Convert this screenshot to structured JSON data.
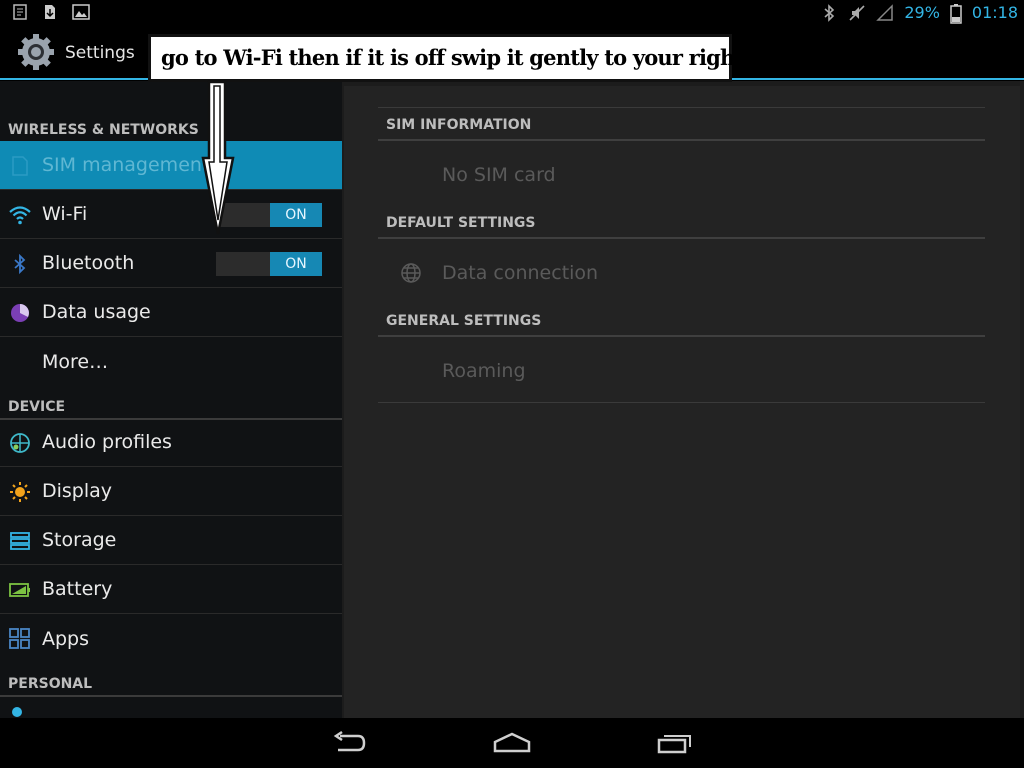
{
  "statusbar": {
    "battery_percent": "29%",
    "time": "01:18",
    "accent": "#33b5e5",
    "left_icons": [
      "notification-icon",
      "download-icon",
      "image-icon"
    ],
    "right_icons": [
      "bluetooth-icon",
      "mute-icon",
      "signal-icon",
      "battery-icon"
    ]
  },
  "actionbar": {
    "title": "Settings",
    "icon": "settings-gear-icon"
  },
  "annotation": {
    "text": "go to Wi-Fi then if it is off swip it gently to your right to ON"
  },
  "sidebar": {
    "sections": [
      {
        "header": "WIRELESS & NETWORKS",
        "items": [
          {
            "label": "SIM management",
            "icon": "sim-icon",
            "selected": true
          },
          {
            "label": "Wi-Fi",
            "icon": "wifi-icon",
            "toggle": "ON"
          },
          {
            "label": "Bluetooth",
            "icon": "bluetooth-icon",
            "toggle": "ON"
          },
          {
            "label": "Data usage",
            "icon": "data-usage-icon"
          },
          {
            "label": "More…",
            "icon": ""
          }
        ]
      },
      {
        "header": "DEVICE",
        "items": [
          {
            "label": "Audio profiles",
            "icon": "audio-profiles-icon"
          },
          {
            "label": "Display",
            "icon": "display-icon"
          },
          {
            "label": "Storage",
            "icon": "storage-icon"
          },
          {
            "label": "Battery",
            "icon": "battery-icon"
          },
          {
            "label": "Apps",
            "icon": "apps-icon"
          }
        ]
      },
      {
        "header": "PERSONAL",
        "items": []
      }
    ]
  },
  "detail": {
    "sim_info_header": "SIM INFORMATION",
    "no_sim": "No SIM card",
    "default_header": "DEFAULT SETTINGS",
    "data_connection": "Data connection",
    "general_header": "GENERAL SETTINGS",
    "roaming": "Roaming"
  },
  "navbar": {
    "buttons": [
      "back-icon",
      "home-icon",
      "recent-apps-icon"
    ]
  }
}
